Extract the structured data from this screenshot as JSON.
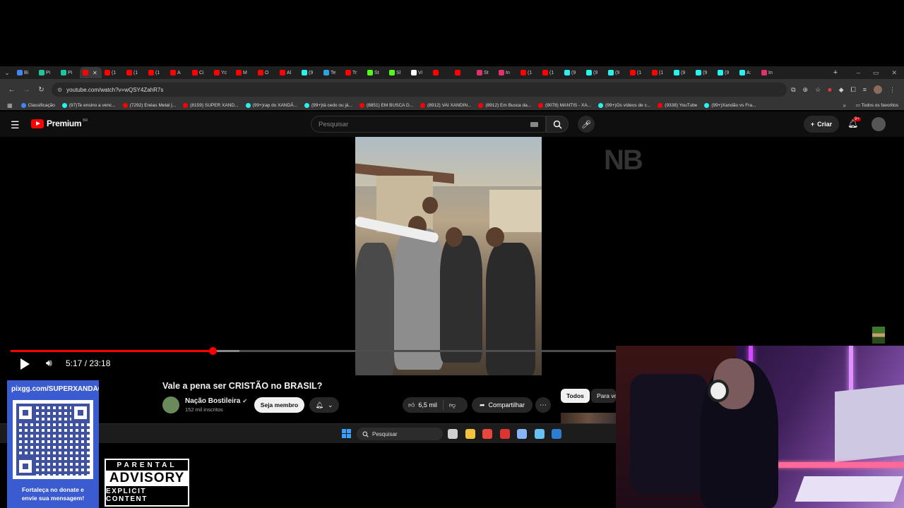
{
  "browser": {
    "tabs": [
      {
        "label": "Bi",
        "color": "#4285f4"
      },
      {
        "label": "Pi",
        "color": "#1ec6a0"
      },
      {
        "label": "Pi",
        "color": "#1ec6a0"
      },
      {
        "label": "",
        "color": "#ff0000",
        "active": true
      },
      {
        "label": "(1",
        "color": "#ff0000"
      },
      {
        "label": "(1",
        "color": "#ff0000"
      },
      {
        "label": "(1",
        "color": "#ff0000"
      },
      {
        "label": "A",
        "color": "#ff0000"
      },
      {
        "label": "Ci",
        "color": "#ff0000"
      },
      {
        "label": "Yc",
        "color": "#ff0000"
      },
      {
        "label": "M",
        "color": "#ff0000"
      },
      {
        "label": "O",
        "color": "#ff0000"
      },
      {
        "label": "Al",
        "color": "#ff0000"
      },
      {
        "label": "(9",
        "color": "#25f4ee"
      },
      {
        "label": "Te",
        "color": "#2aa3e0"
      },
      {
        "label": "Tr",
        "color": "#ff0000"
      },
      {
        "label": "St",
        "color": "#53fc18"
      },
      {
        "label": "Sl",
        "color": "#53fc18"
      },
      {
        "label": "Vi",
        "color": "#ffffff"
      },
      {
        "label": "",
        "color": "#ff0000"
      },
      {
        "label": "",
        "color": "#ff0000"
      },
      {
        "label": "St",
        "color": "#e1306c"
      },
      {
        "label": "In",
        "color": "#e1306c"
      },
      {
        "label": "(1",
        "color": "#ff0000"
      },
      {
        "label": "(1",
        "color": "#ff0000"
      },
      {
        "label": "(9",
        "color": "#25f4ee"
      },
      {
        "label": "(9",
        "color": "#25f4ee"
      },
      {
        "label": "(9",
        "color": "#25f4ee"
      },
      {
        "label": "(1",
        "color": "#ff0000"
      },
      {
        "label": "(1",
        "color": "#ff0000"
      },
      {
        "label": "(9",
        "color": "#25f4ee"
      },
      {
        "label": "(9",
        "color": "#25f4ee"
      },
      {
        "label": "(9",
        "color": "#25f4ee"
      },
      {
        "label": "A:",
        "color": "#25f4ee"
      },
      {
        "label": "In",
        "color": "#e1306c"
      }
    ],
    "new_tab": "+",
    "window_controls": [
      "–",
      "▭",
      "✕"
    ],
    "url": "youtube.com/watch?v=wQSY4ZahR7s",
    "bookmarks": [
      {
        "label": "Classificação",
        "color": "#4285f4"
      },
      {
        "label": "(97)Te ensino a venc...",
        "color": "#25f4ee"
      },
      {
        "label": "(7292) Enéas Metal |...",
        "color": "#ff0000"
      },
      {
        "label": "(8159) SUPER XAND...",
        "color": "#ff0000"
      },
      {
        "label": "(99+)rap do XANDÃ...",
        "color": "#25f4ee"
      },
      {
        "label": "(99+)tá cedo ou já...",
        "color": "#25f4ee"
      },
      {
        "label": "(8851) EM BUSCA D...",
        "color": "#ff0000"
      },
      {
        "label": "(8912) VAI XANDIN...",
        "color": "#ff0000"
      },
      {
        "label": "(8912) Em Busca da...",
        "color": "#ff0000"
      },
      {
        "label": "(9078) MANTIS - XA...",
        "color": "#ff0000"
      },
      {
        "label": "(99+)Os vídeos de c...",
        "color": "#25f4ee"
      },
      {
        "label": "(9338) YouTube",
        "color": "#ff0000"
      },
      {
        "label": "(99+)Xandão vs Fra...",
        "color": "#25f4ee"
      }
    ],
    "bookmarks_more": "»",
    "all_bookmarks": "Todos os favoritos"
  },
  "youtube": {
    "logo_text": "Premium",
    "logo_region": "BR",
    "search_placeholder": "Pesquisar",
    "create_label": "Criar",
    "notif_badge": "9+",
    "watermark": "NB",
    "player": {
      "current_time": "5:17",
      "duration": "23:18",
      "time_display": "5:17 / 23:18",
      "played_fraction": 0.3338,
      "buffered_fraction": 0.378
    },
    "video_title": "Vale a pena ser CRISTÃO no BRASIL?",
    "channel_name": "Nação Bostileira",
    "verified_icon": "✔",
    "subscribers": "152 mil inscritos",
    "join_label": "Seja membro",
    "likes": "6,5 mil",
    "share_label": "Compartilhar",
    "chips": [
      "Todos",
      "Para você"
    ]
  },
  "taskbar": {
    "search_placeholder": "Pesquisar",
    "apps": [
      {
        "name": "task-view-icon",
        "color": "#cfcfcf"
      },
      {
        "name": "file-explorer-icon",
        "color": "#f3c33b"
      },
      {
        "name": "chrome-icon",
        "color": "#e8453c"
      },
      {
        "name": "red-app-icon",
        "color": "#d33"
      },
      {
        "name": "settings-icon",
        "color": "#8ab4f8"
      },
      {
        "name": "steam-icon",
        "color": "#66c0f4"
      },
      {
        "name": "blue-app-icon",
        "color": "#2d7dd2"
      }
    ]
  },
  "overlay": {
    "donate_url": "pixgg.com/SUPERXANDÃO",
    "donate_message_line1": "Fortaleça no donate e",
    "donate_message_line2": "envie sua mensagem!",
    "advisory_top": "PARENTAL",
    "advisory_middle": "ADVISORY",
    "advisory_bottom": "EXPLICIT CONTENT"
  }
}
